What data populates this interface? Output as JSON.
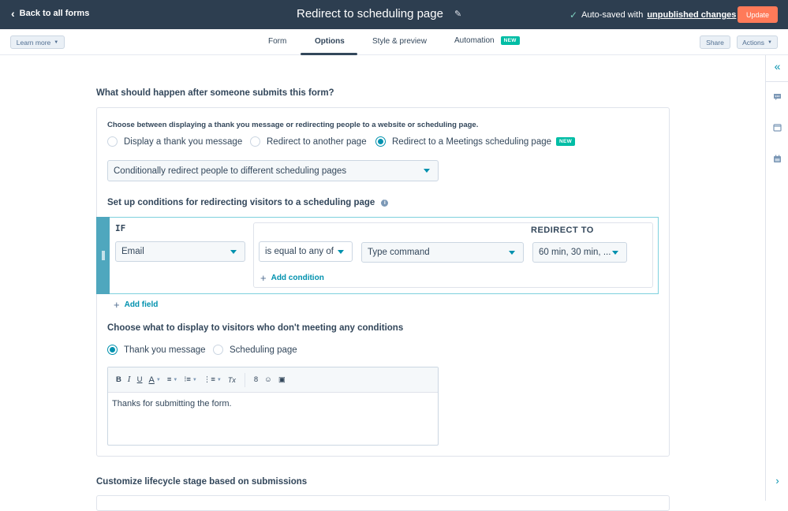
{
  "topbar": {
    "back_label": "Back to all forms",
    "title": "Redirect to scheduling page",
    "autosave_prefix": "Auto-saved with",
    "autosave_link": "unpublished changes",
    "update_label": "Update"
  },
  "subnav": {
    "learn_more": "Learn more",
    "tabs": [
      {
        "label": "Form"
      },
      {
        "label": "Options"
      },
      {
        "label": "Style & preview"
      },
      {
        "label": "Automation",
        "badge": "NEW"
      }
    ],
    "active_tab": "Options",
    "share_label": "Share",
    "actions_label": "Actions"
  },
  "main": {
    "section1_title": "What should happen after someone submits this form?",
    "description": "Choose between displaying a thank you message or redirecting people to a website or scheduling page.",
    "radios": [
      {
        "label": "Display a thank you message",
        "selected": false
      },
      {
        "label": "Redirect to another page",
        "selected": false
      },
      {
        "label": "Redirect to a Meetings scheduling page",
        "selected": true,
        "badge": "NEW"
      }
    ],
    "redirect_mode_select": "Conditionally redirect people to different scheduling pages",
    "conditions_title": "Set up conditions for redirecting visitors to a scheduling page",
    "if_label": "IF",
    "redirect_to_label": "REDIRECT TO",
    "field_select": "Email",
    "operator_select": "is equal to any of",
    "value_select": "Type command",
    "redirect_select": "60 min, 30 min, ...",
    "add_condition": "Add condition",
    "add_field": "Add field",
    "fallback_title": "Choose what to display to visitors who don't meeting any conditions",
    "fallback_radios": [
      {
        "label": "Thank you message",
        "selected": true
      },
      {
        "label": "Scheduling page",
        "selected": false
      }
    ],
    "editor_text": "Thanks for submitting the form.",
    "toolbar": {
      "bold": "B",
      "italic": "I",
      "underline": "U",
      "color": "A",
      "align": "≡",
      "bullets": "⁝≡",
      "numbers": "⋮≡",
      "clear": "Tx",
      "link": "8",
      "emoji": "☺",
      "image": "▣"
    },
    "section2_title": "Customize lifecycle stage based on submissions"
  },
  "rightbar": {
    "icons": [
      "collapse-icon",
      "chat-icon",
      "window-icon",
      "calendar-icon",
      "chevron-right-icon"
    ]
  },
  "colors": {
    "topbar": "#2d3e50",
    "accent": "#0091ae",
    "update_button": "#ff7a59",
    "new_badge": "#00bda5",
    "drag_handle": "#4fa7be"
  }
}
